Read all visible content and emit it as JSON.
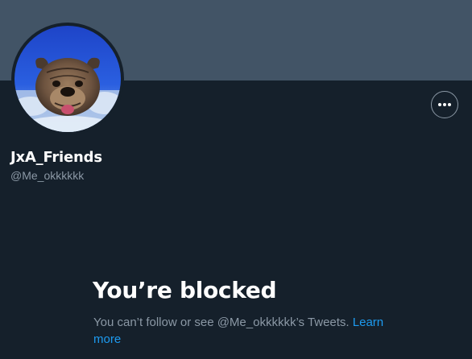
{
  "profile": {
    "display_name": "JxA_Friends",
    "handle": "@Me_okkkkkk",
    "avatar_icon": "bulldog-avatar",
    "banner_color": "#425466"
  },
  "more_button": {
    "icon": "ellipsis-icon"
  },
  "blocked": {
    "title": "You’re blocked",
    "message": "You can’t follow or see @Me_okkkkkk’s Tweets.",
    "link_label": "Learn more"
  },
  "colors": {
    "background": "#15202b",
    "muted_text": "#8b98a5",
    "link": "#1d9bf0",
    "text": "#ffffff"
  }
}
